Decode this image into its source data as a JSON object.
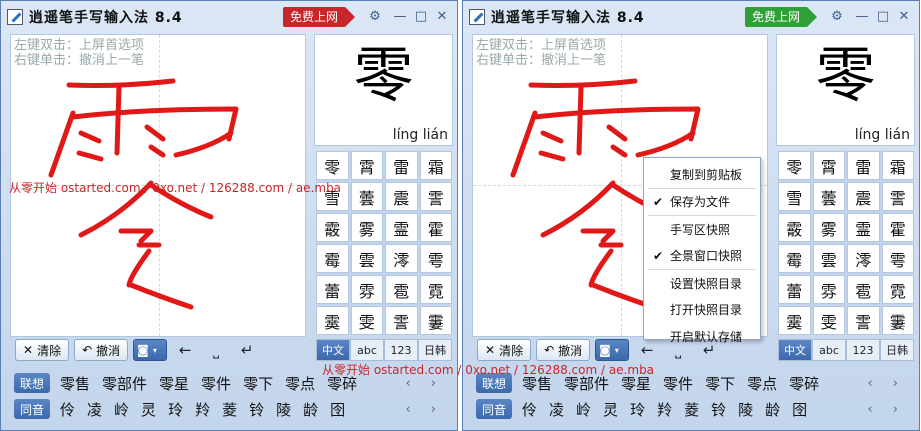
{
  "app": {
    "title": "逍遥笔手写输入法 8.4"
  },
  "window1": {
    "promo": "免费上网",
    "promo_color": "#c8262a"
  },
  "window2": {
    "promo": "免费上网",
    "promo_color": "#2fa035"
  },
  "hints": {
    "line1": "左键双击：上屏首选项",
    "line2": "右键单击：撤消上一笔"
  },
  "controls": {
    "clear": "清除",
    "undo": "撤消"
  },
  "preview": {
    "char": "零",
    "pinyin": "líng lián"
  },
  "candidates": [
    "零",
    "霄",
    "雷",
    "霜",
    "雪",
    "蕓",
    "震",
    "霅",
    "霰",
    "雾",
    "霊",
    "霍",
    "霉",
    "雲",
    "澪",
    "雩",
    "蕾",
    "雰",
    "雹",
    "霓",
    "霙",
    "雯",
    "霅",
    "霋"
  ],
  "modes": [
    "中文",
    "abc",
    "123",
    "日韩"
  ],
  "assoc": {
    "label": "联想",
    "words": [
      "零售",
      "零部件",
      "零星",
      "零件",
      "零下",
      "零点",
      "零碎"
    ]
  },
  "homophone": {
    "label": "同音",
    "words": [
      "伶",
      "凌",
      "岭",
      "灵",
      "玲",
      "羚",
      "菱",
      "铃",
      "陵",
      "龄",
      "囹"
    ]
  },
  "menu": {
    "items": [
      {
        "label": "复制到剪贴板",
        "checked": false
      },
      {
        "label": "保存为文件",
        "checked": true
      },
      {
        "label": "手写区快照",
        "checked": false
      },
      {
        "label": "全景窗口快照",
        "checked": true
      },
      {
        "label": "设置快照目录",
        "checked": false
      },
      {
        "label": "打开快照目录",
        "checked": false
      },
      {
        "label": "开启默认存储",
        "checked": false
      }
    ]
  },
  "watermark": "从零开始 ostarted.com / 0xo.net / 126288.com / ae.mba"
}
